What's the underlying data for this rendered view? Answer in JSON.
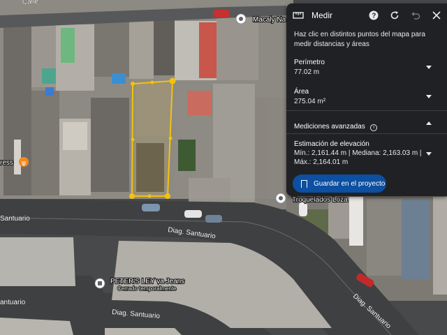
{
  "map": {
    "labels": {
      "calle_top": "Calle",
      "diag_santuario_left": "Diag. Santuario",
      "diag_santuario_mid": "Diag. Santuario",
      "diag_santuario_bottom": "Diag. Santuario",
      "diag_santuario_right": "Diag. Santuario",
      "santuario_bl": "antuario",
      "santuario_left": "Santuario"
    },
    "pois": {
      "macaly": "Macaly Na",
      "troquelados": "Troquelados Loza",
      "peters": "PETER'S LEY va Jeans",
      "peters_status": "Cerrado temporalmente",
      "express": "ress"
    }
  },
  "panel": {
    "title": "Medir",
    "description": "Haz clic en distintos puntos del mapa para medir distancias y áreas",
    "perimeter_label": "Perímetro",
    "perimeter_value": "77.02 m",
    "area_label": "Área",
    "area_value": "275.04 m²",
    "advanced_label": "Mediciones avanzadas",
    "elevation_label": "Estimación de elevación",
    "elevation_line1": "Mín.: 2,161.44 m | Mediana: 2,163.03 m |",
    "elevation_line2": "Máx.: 2,164.01 m",
    "save_button": "Guardar en el proyecto"
  },
  "colors": {
    "panel_bg": "#202124",
    "accent_blue": "#0d4fa0",
    "measure_yellow": "#f4c20d"
  },
  "icons": [
    "ruler-icon",
    "help-icon",
    "refresh-icon",
    "undo-icon",
    "close-icon",
    "info-icon",
    "bookmark-icon",
    "place-pin-icon",
    "restaurant-icon"
  ]
}
